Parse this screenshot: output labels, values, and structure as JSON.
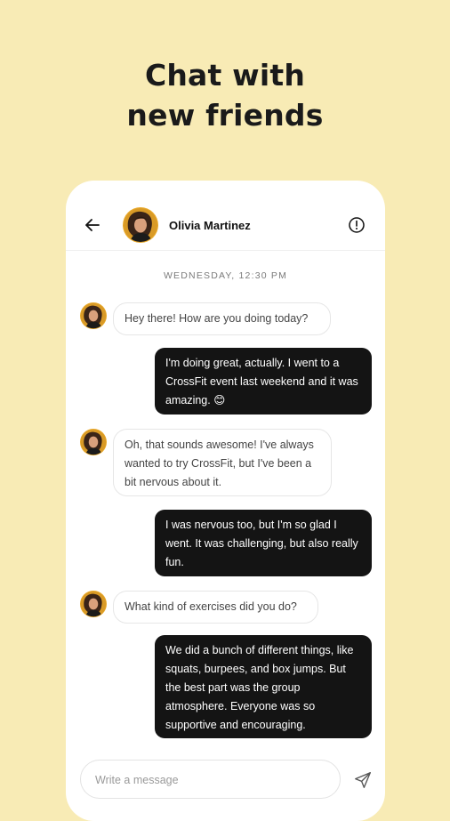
{
  "promo": {
    "headline_line1": "Chat with",
    "headline_line2": "new friends",
    "background_color": "#F8EBB5"
  },
  "chat": {
    "header": {
      "back_icon": "arrow-left-icon",
      "contact_name": "Olivia Martinez",
      "report_icon": "alert-circle-icon"
    },
    "timestamp": "WEDNESDAY, 12:30 PM",
    "messages": [
      {
        "from": "contact",
        "text": "Hey there! How are you doing today?"
      },
      {
        "from": "me",
        "text": "I'm doing great, actually. I went to a CrossFit event last weekend and it was amazing. 😊"
      },
      {
        "from": "contact",
        "text": "Oh, that sounds awesome! I've always wanted to try CrossFit, but I've been a bit nervous about it."
      },
      {
        "from": "me",
        "text": "I was nervous too, but I'm so glad I went. It was challenging, but also really fun."
      },
      {
        "from": "contact",
        "text": "What kind of exercises did you do?"
      },
      {
        "from": "me",
        "text": "We did a bunch of different things, like squats, burpees, and box jumps. But the best part was the group atmosphere. Everyone was so supportive and encouraging."
      }
    ],
    "composer": {
      "placeholder": "Write a message",
      "value": "",
      "send_icon": "send-icon"
    },
    "colors": {
      "outgoing_bubble": "#141414",
      "incoming_bubble": "#ffffff",
      "accent": "#E9A92A"
    }
  }
}
